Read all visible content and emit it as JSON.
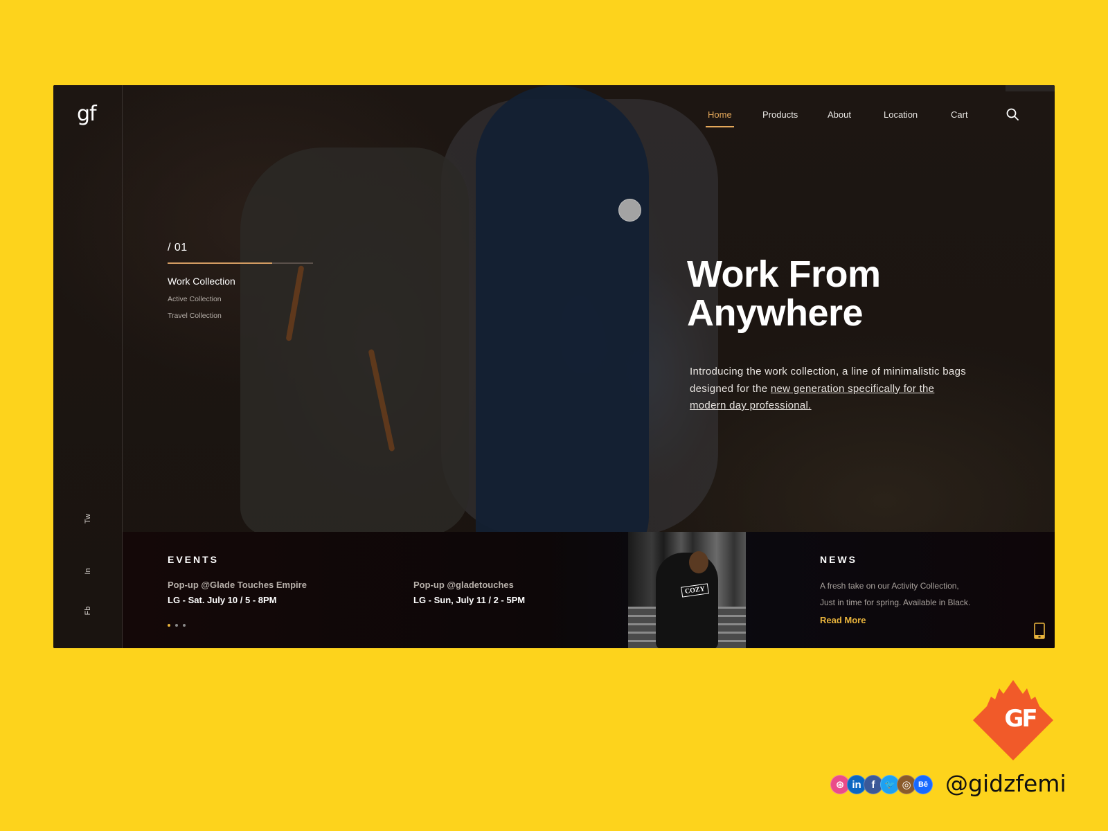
{
  "logo": "gf",
  "nav": {
    "items": [
      {
        "label": "Home",
        "active": true
      },
      {
        "label": "Products",
        "active": false
      },
      {
        "label": "About",
        "active": false
      },
      {
        "label": "Location",
        "active": false
      },
      {
        "label": "Cart",
        "active": false
      }
    ],
    "search_icon": "search-icon"
  },
  "social_sidebar": [
    "Tw",
    "In",
    "Fb"
  ],
  "collection": {
    "index": "/ 01",
    "progress": 0.72,
    "active": "Work Collection",
    "items": [
      "Active Collection",
      "Travel Collection"
    ]
  },
  "hero": {
    "title_line1": "Work From",
    "title_line2": "Anywhere",
    "desc_plain": "Introducing the work collection, a line of minimalistic bags designed for the ",
    "desc_link": "new generation specifically for the modern day professional."
  },
  "events": {
    "title": "EVENTS",
    "items": [
      {
        "name": "Pop-up @Glade Touches Empire",
        "date": "LG - Sat. July 10 / 5 - 8PM"
      },
      {
        "name": "Pop-up @gladetouches",
        "date": "LG - Sun, July 11 / 2 - 5PM"
      }
    ],
    "pager": {
      "total": 3,
      "current": 1
    }
  },
  "news": {
    "image_label": "COZY",
    "title": "NEWS",
    "line1": "A fresh take on our Activity Collection,",
    "line2": "Just in time for spring. Available in Black.",
    "read_more": "Read More",
    "device_icon": "tablet-icon"
  },
  "branding": {
    "logo_text": "GF",
    "handle": "@gidzfemi",
    "socials": [
      {
        "name": "dribbble",
        "glyph": "⊛",
        "color": "#EA4C89"
      },
      {
        "name": "linkedin",
        "glyph": "in",
        "color": "#0A66C2"
      },
      {
        "name": "facebook",
        "glyph": "f",
        "color": "#3B5998"
      },
      {
        "name": "twitter",
        "glyph": "🐦",
        "color": "#1DA1F2"
      },
      {
        "name": "instagram",
        "glyph": "◎",
        "color": "#8A5A2B"
      },
      {
        "name": "behance",
        "glyph": "Bē",
        "color": "#1769FF"
      }
    ]
  },
  "colors": {
    "background": "#FDD31C",
    "accent": "#E4A85A",
    "read_more": "#E8B33C",
    "brand_orange": "#F15A29"
  }
}
